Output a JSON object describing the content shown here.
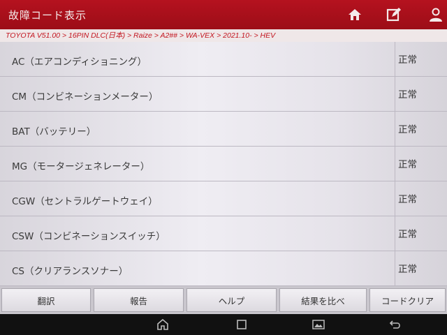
{
  "header": {
    "title": "故障コード表示",
    "icons": [
      "home-icon",
      "edit-note-icon",
      "user-icon"
    ]
  },
  "breadcrumb": "TOYOTA V51.00 > 16PIN DLC(日本) > Raize > A2## > WA-VEX > 2021.10- > HEV",
  "systems": [
    {
      "name": "AC（エアコンディショニング）",
      "status": "正常"
    },
    {
      "name": "CM（コンビネーションメーター）",
      "status": "正常"
    },
    {
      "name": "BAT（バッテリー）",
      "status": "正常"
    },
    {
      "name": "MG（モータージェネレーター）",
      "status": "正常"
    },
    {
      "name": "CGW（セントラルゲートウェイ）",
      "status": "正常"
    },
    {
      "name": "CSW（コンビネーションスイッチ）",
      "status": "正常"
    },
    {
      "name": "CS（クリアランスソナー）",
      "status": "正常"
    }
  ],
  "toolbar": {
    "translate": "翻訳",
    "report": "報告",
    "help": "ヘルプ",
    "compare": "結果を比べ",
    "clear_codes": "コードクリア"
  },
  "colors": {
    "header_bg": "#b5121f",
    "breadcrumb_text": "#c2151f"
  }
}
